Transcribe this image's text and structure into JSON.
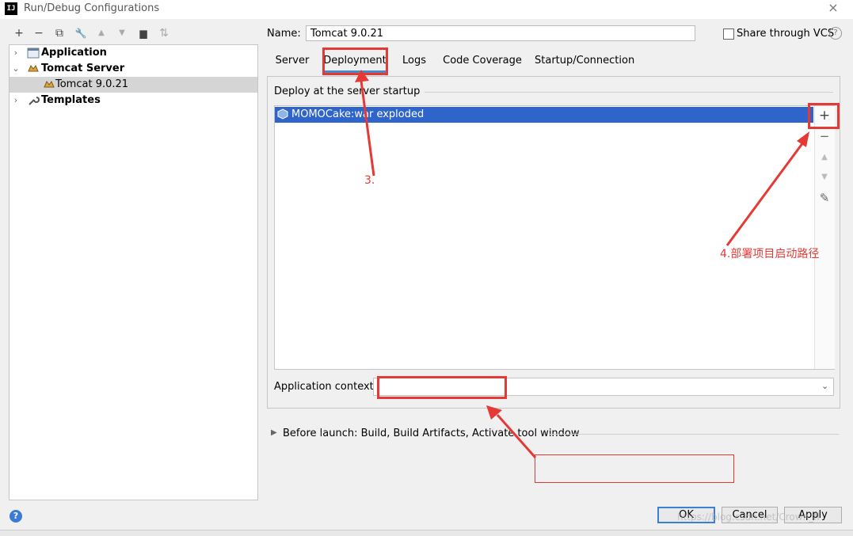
{
  "window": {
    "title": "Run/Debug Configurations",
    "logo_text": "IJ",
    "close_glyph": "×"
  },
  "toolbar": {
    "icons": [
      "add-icon",
      "remove-icon",
      "copy-icon",
      "wrench-icon",
      "move-up-icon",
      "move-down-icon",
      "folder-icon",
      "sort-icon"
    ],
    "glyphs": {
      "add": "+",
      "remove": "−",
      "copy": "⧉",
      "wrench": "🔧",
      "up": "▲",
      "down": "▼",
      "folder": "▆",
      "sort": "⇅"
    }
  },
  "tree": {
    "items": [
      {
        "label": "Application",
        "bold": true,
        "expanded": false
      },
      {
        "label": "Tomcat Server",
        "bold": true,
        "expanded": true
      },
      {
        "label": "Tomcat 9.0.21",
        "bold": false,
        "selected": true
      },
      {
        "label": "Templates",
        "bold": true,
        "expanded": false
      }
    ]
  },
  "config": {
    "name_label": "Name:",
    "name_value": "Tomcat 9.0.21",
    "share_label": "Share through VCS",
    "share_checked": false
  },
  "tabs": [
    {
      "label": "Server",
      "active": false
    },
    {
      "label": "Deployment",
      "active": true
    },
    {
      "label": "Logs",
      "active": false
    },
    {
      "label": "Code Coverage",
      "active": false
    },
    {
      "label": "Startup/Connection",
      "active": false
    }
  ],
  "deployment": {
    "section_title": "Deploy at the server startup",
    "artifacts": [
      "MOMOCake:war exploded"
    ],
    "side_buttons": {
      "add": "+",
      "remove": "−",
      "up": "▲",
      "down": "▼",
      "edit": "✎"
    },
    "app_context_label": "Application context:",
    "app_context_value": "",
    "dropdown_glyph": "⌄"
  },
  "before_launch": {
    "text": "Before launch: Build, Build Artifacts, Activate tool window"
  },
  "buttons": {
    "ok": "OK",
    "cancel": "Cancel",
    "apply": "Apply",
    "help": "?"
  },
  "annotations": {
    "step3": "3.",
    "step4": "4.部署项目启动路径",
    "watermark": "https://blog.csdn.net/Crown_fl"
  },
  "colors": {
    "accent": "#2f65ca",
    "annotation_red": "#e53935",
    "tab_underline": "#4a88c7"
  }
}
